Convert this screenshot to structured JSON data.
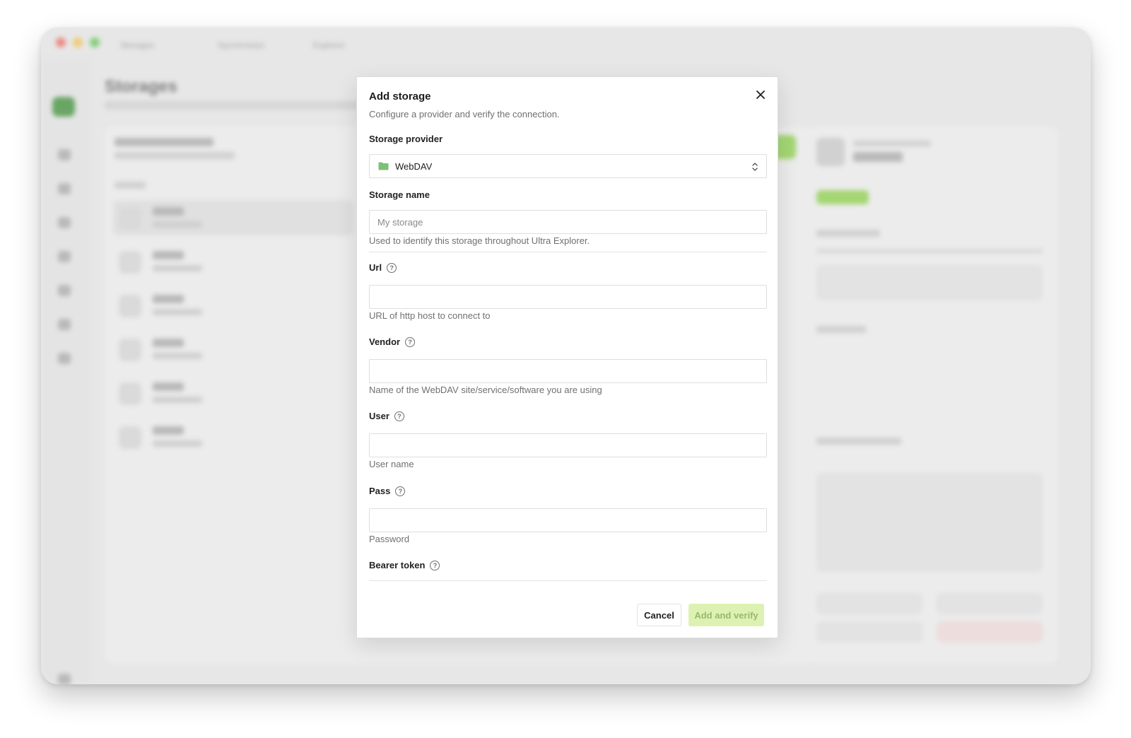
{
  "background": {
    "title": "Storages",
    "tabs": [
      "Storages",
      "Synchronize",
      "Explorer"
    ]
  },
  "dialog": {
    "title": "Add storage",
    "subtitle": "Configure a provider and verify the connection.",
    "provider": {
      "label": "Storage provider",
      "value": "WebDAV",
      "icon": "folder-icon"
    },
    "name": {
      "label": "Storage name",
      "placeholder": "My storage",
      "value": "",
      "hint": "Used to identify this storage throughout Ultra Explorer."
    },
    "url": {
      "label": "Url",
      "value": "",
      "hint": "URL of http host to connect to"
    },
    "vendor": {
      "label": "Vendor",
      "value": "",
      "hint": "Name of the WebDAV site/service/software you are using"
    },
    "user": {
      "label": "User",
      "value": "",
      "hint": "User name"
    },
    "pass": {
      "label": "Pass",
      "value": "",
      "hint": "Password"
    },
    "bearer": {
      "label": "Bearer token"
    },
    "cancel_label": "Cancel",
    "submit_label": "Add and verify",
    "help_glyph": "?"
  },
  "colors": {
    "accent": "#8ccf4a",
    "submit_bg": "#ddf2b2",
    "submit_text": "#98b96d",
    "folder": "#7cc07a"
  }
}
